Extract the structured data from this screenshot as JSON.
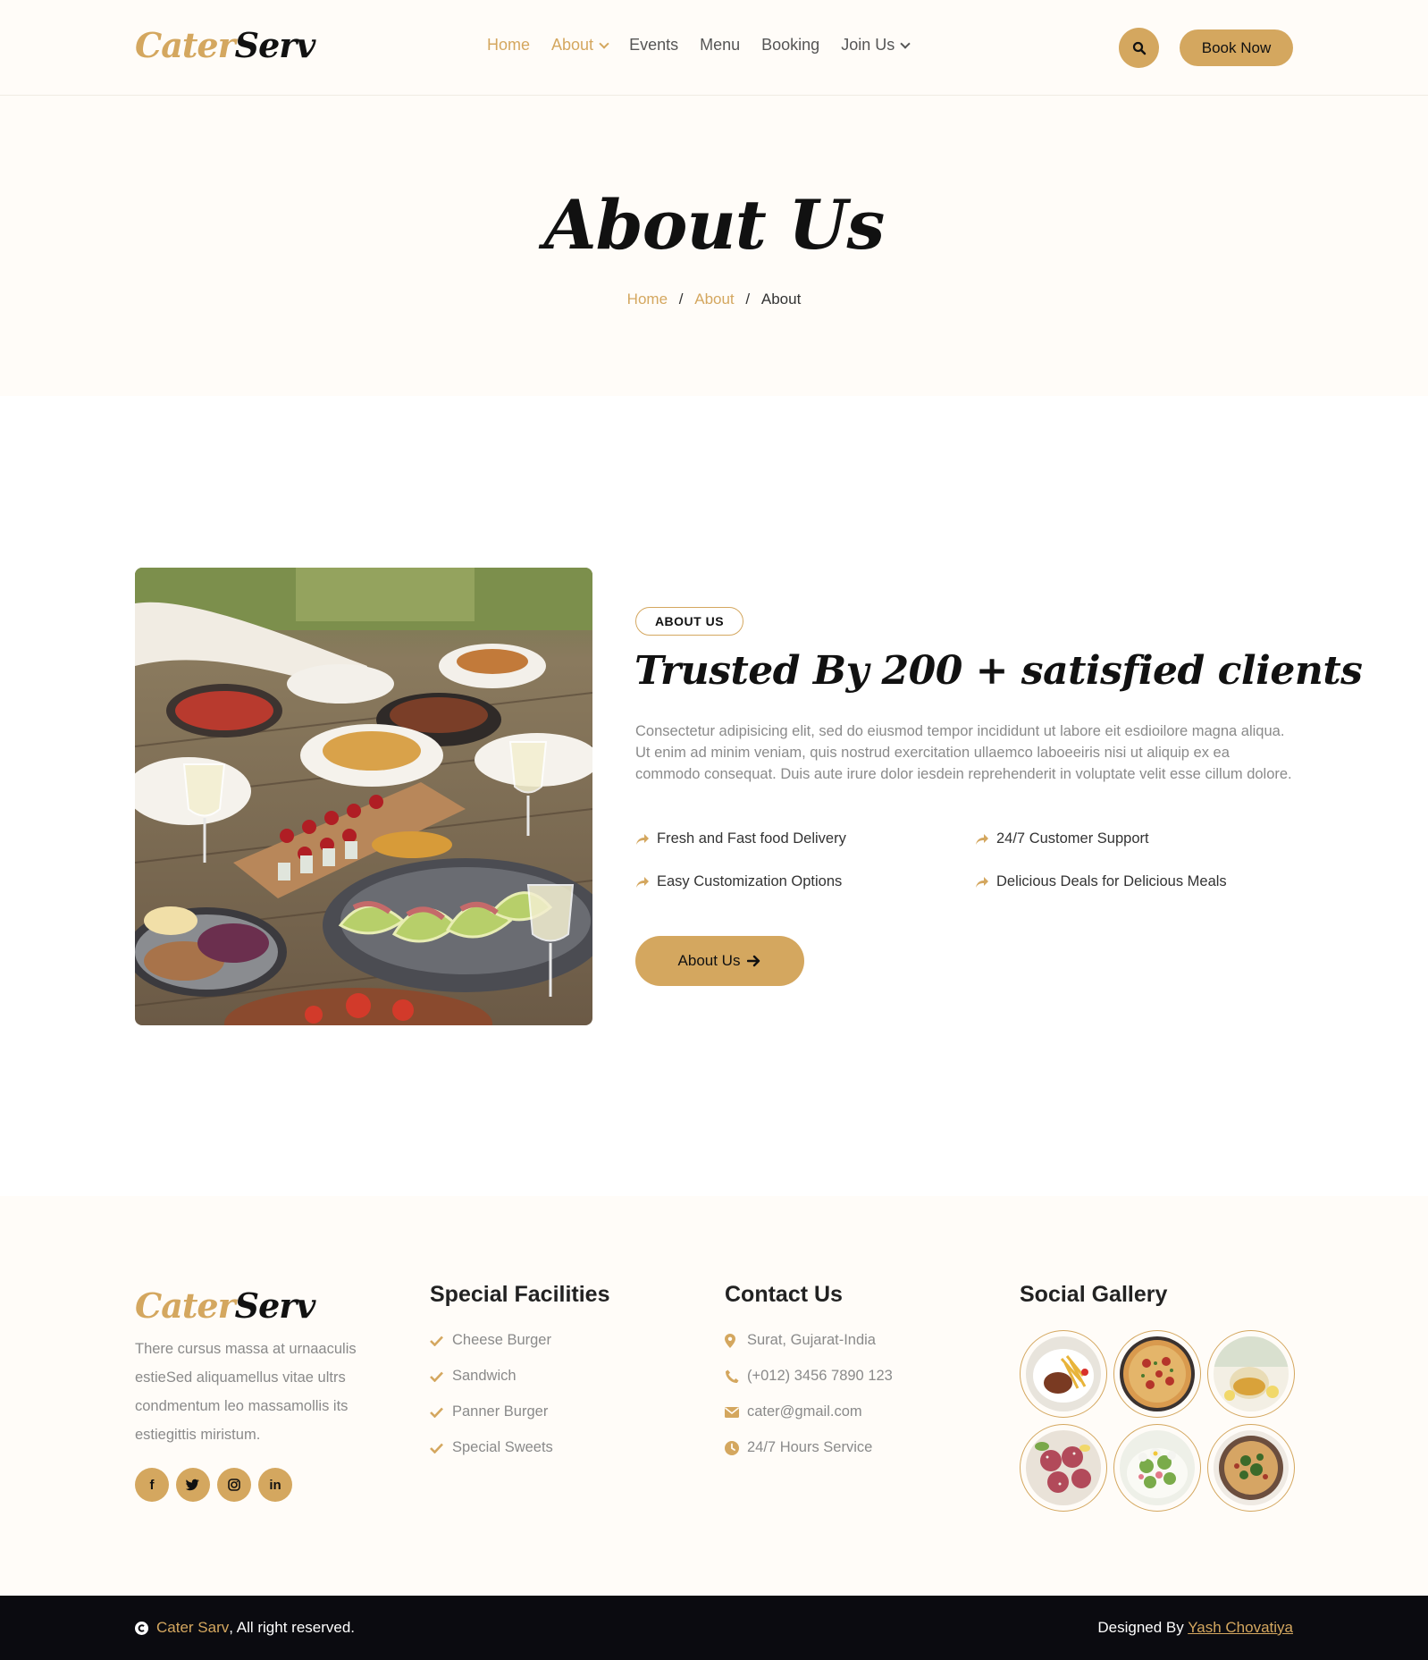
{
  "brand": {
    "logo_part1": "Cater",
    "logo_part2": "Serv"
  },
  "nav": {
    "items": [
      {
        "label": "Home",
        "active": true,
        "dropdown": false
      },
      {
        "label": "About",
        "active": true,
        "dropdown": true
      },
      {
        "label": "Events",
        "active": false,
        "dropdown": false
      },
      {
        "label": "Menu",
        "active": false,
        "dropdown": false
      },
      {
        "label": "Booking",
        "active": false,
        "dropdown": false
      },
      {
        "label": "Join Us",
        "active": false,
        "dropdown": true
      }
    ],
    "search_icon": "search-icon",
    "book_now": "Book Now"
  },
  "hero": {
    "title": "About Us",
    "breadcrumb": [
      "Home",
      "About",
      "About"
    ],
    "separator": "/"
  },
  "about": {
    "badge": "ABOUT US",
    "heading": "Trusted By 200 + satisfied clients",
    "text": "Consectetur adipisicing elit, sed do eiusmod tempor incididunt ut labore eit esdioilore magna aliqua. Ut enim ad minim veniam, quis nostrud exercitation ullaemco laboeeiris nisi ut aliquip ex ea commodo consequat. Duis aute irure dolor iesdein reprehenderit in voluptate velit esse cillum dolore.",
    "features": [
      "Fresh and Fast food Delivery",
      "24/7 Customer Support",
      "Easy Customization Options",
      "Delicious Deals for Delicious Meals"
    ],
    "button": "About Us",
    "image_alt": "table-food-photo"
  },
  "footer": {
    "logo_part1": "Cater",
    "logo_part2": "Serv",
    "about_text": "There cursus massa at urnaaculis estieSed aliquamellus vitae ultrs condmentum leo massamollis its estiegittis miristum.",
    "social": [
      {
        "icon": "facebook-icon",
        "glyph": "f"
      },
      {
        "icon": "twitter-icon",
        "glyph": "t"
      },
      {
        "icon": "instagram-icon",
        "glyph": "ig"
      },
      {
        "icon": "linkedin-icon",
        "glyph": "in"
      }
    ],
    "facilities": {
      "heading": "Special Facilities",
      "items": [
        "Cheese Burger",
        "Sandwich",
        "Panner Burger",
        "Special Sweets"
      ]
    },
    "contact": {
      "heading": "Contact Us",
      "items": [
        {
          "icon": "location-icon",
          "text": "Surat, Gujarat-India"
        },
        {
          "icon": "phone-icon",
          "text": "(+012) 3456 7890 123"
        },
        {
          "icon": "email-icon",
          "text": "cater@gmail.com"
        },
        {
          "icon": "clock-icon",
          "text": "24/7 Hours Service"
        }
      ]
    },
    "gallery": {
      "heading": "Social Gallery"
    }
  },
  "bottom": {
    "brand": "Cater Sarv",
    "rights": ", All right reserved.",
    "designed_by": "Designed By ",
    "designer": "Yash Chovatiya"
  },
  "colors": {
    "accent": "#D4A75F",
    "cream": "#FFFCF8",
    "dark": "#0B0B10"
  }
}
